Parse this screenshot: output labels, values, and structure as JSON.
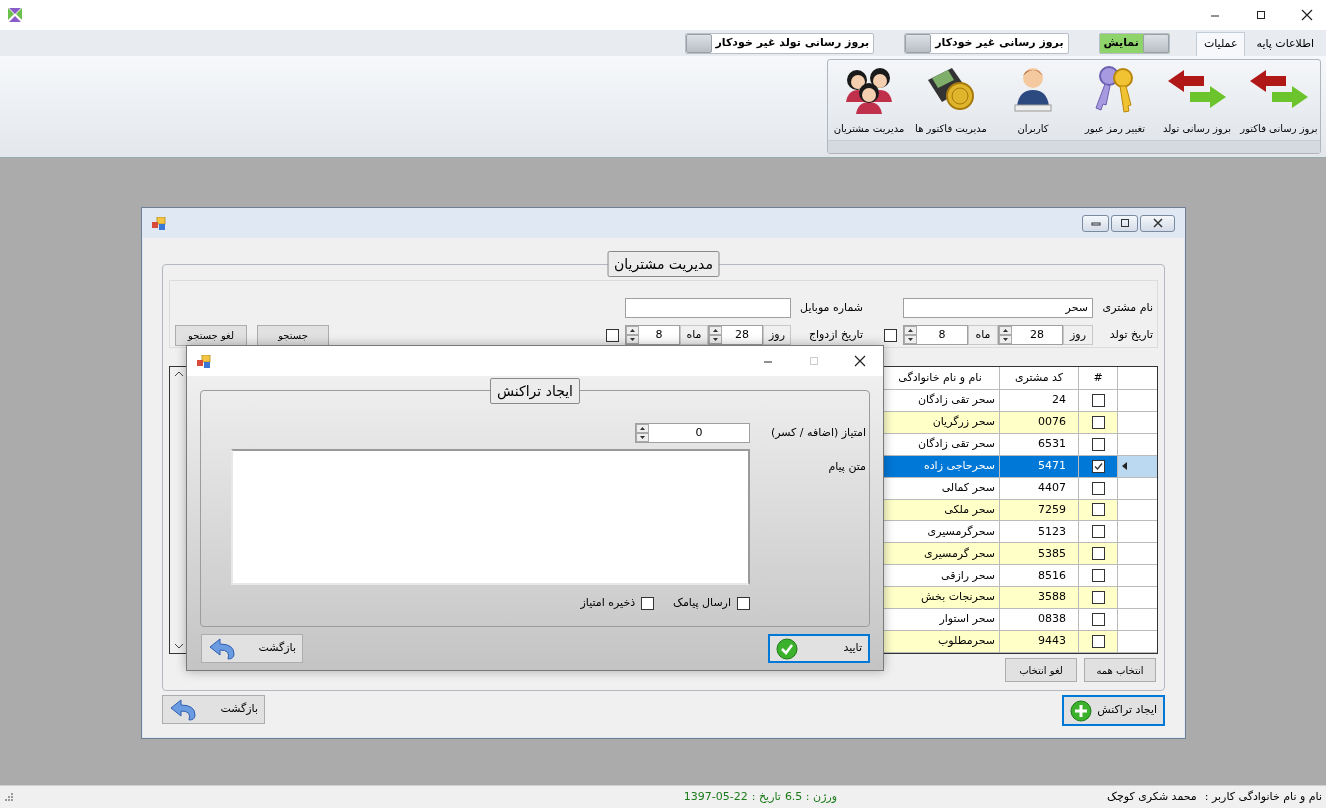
{
  "tabs": [
    {
      "label": "اطلاعات پایه",
      "selected": false
    },
    {
      "label": "عملیات",
      "selected": true
    }
  ],
  "toggles": [
    {
      "label": "نمایش",
      "on": true
    },
    {
      "label": "بروز رسانی غیر خودکار",
      "on": false
    },
    {
      "label": "بروز رسانی تولد غیر خودکار",
      "on": false
    }
  ],
  "ribbon": {
    "items": [
      {
        "label": "بروز رسانی فاکتور",
        "kind": "arrows"
      },
      {
        "label": "بروز رسانی تولد",
        "kind": "arrows"
      },
      {
        "label": "تغییر رمز عبور",
        "kind": "keys"
      },
      {
        "label": "کاربران",
        "kind": "user"
      },
      {
        "label": "مدیریت فاکتور ها",
        "kind": "wallet"
      },
      {
        "label": "مدیریت مشتریان",
        "kind": "people"
      }
    ]
  },
  "customer_window": {
    "title": "مدیریت مشتریان",
    "filters": {
      "name": {
        "label": "نام مشتری",
        "value": "سحر"
      },
      "mobile": {
        "label": "شماره موبایل"
      },
      "birth_date": {
        "label": "تاریخ تولد",
        "checked": false,
        "day_label": "روز",
        "day": "28",
        "month_label": "ماه",
        "month": "8"
      },
      "marriage_date": {
        "label": "تاریخ ازدواج",
        "checked": false,
        "day_label": "روز",
        "day": "28",
        "month_label": "ماه",
        "month": "8"
      }
    },
    "search_button": "جستجو",
    "clear_search_button": "لغو جستجو",
    "table": {
      "columns": [
        "#",
        "کد مشتری",
        "نام و نام خانوادگی"
      ],
      "rows": [
        {
          "checked": false,
          "selected": false,
          "code": "24",
          "name": "سحر تقی زادگان"
        },
        {
          "checked": false,
          "selected": false,
          "code": "0076",
          "name": "سحر زرگریان"
        },
        {
          "checked": false,
          "selected": false,
          "code": "6531",
          "name": "سحر تقی زادگان"
        },
        {
          "checked": true,
          "selected": true,
          "code": "5471",
          "name": "سحرحاجی زاده"
        },
        {
          "checked": false,
          "selected": false,
          "code": "4407",
          "name": "سحر کمالی"
        },
        {
          "checked": false,
          "selected": false,
          "code": "7259",
          "name": "سحر ملکی"
        },
        {
          "checked": false,
          "selected": false,
          "code": "5123",
          "name": "سحرگرمسیری"
        },
        {
          "checked": false,
          "selected": false,
          "code": "5385",
          "name": "سحر گرمسیری"
        },
        {
          "checked": false,
          "selected": false,
          "code": "8516",
          "name": "سحر رازقی"
        },
        {
          "checked": false,
          "selected": false,
          "code": "3588",
          "name": "سحرنجات بخش"
        },
        {
          "checked": false,
          "selected": false,
          "code": "0838",
          "name": "سحر استوار"
        },
        {
          "checked": false,
          "selected": false,
          "code": "9443",
          "name": "سحرمطلوب"
        }
      ]
    },
    "select_all_button": "انتخاب همه",
    "deselect_button": "لغو انتخاب",
    "create_transaction_button": "ایجاد تراکنش",
    "back_button": "بازگشت"
  },
  "dialog": {
    "title": "ایجاد تراکنش",
    "score": {
      "label": "امتیاز (اضافه / کسر)",
      "value": "0"
    },
    "message": {
      "label": "متن پیام"
    },
    "checkboxes": [
      {
        "label": "ارسال پیامک",
        "checked": false
      },
      {
        "label": "ذخیره امتیاز",
        "checked": false
      }
    ],
    "confirm_button": "تایید",
    "back_button": "بازگشت"
  },
  "status_bar": {
    "user_label": "نام و نام خانوادگی کاربر :",
    "user_name": "محمد شکری کوچک",
    "version": "ورژن : 6.5",
    "date_label": "تاریخ :",
    "date": "1397-05-22"
  }
}
